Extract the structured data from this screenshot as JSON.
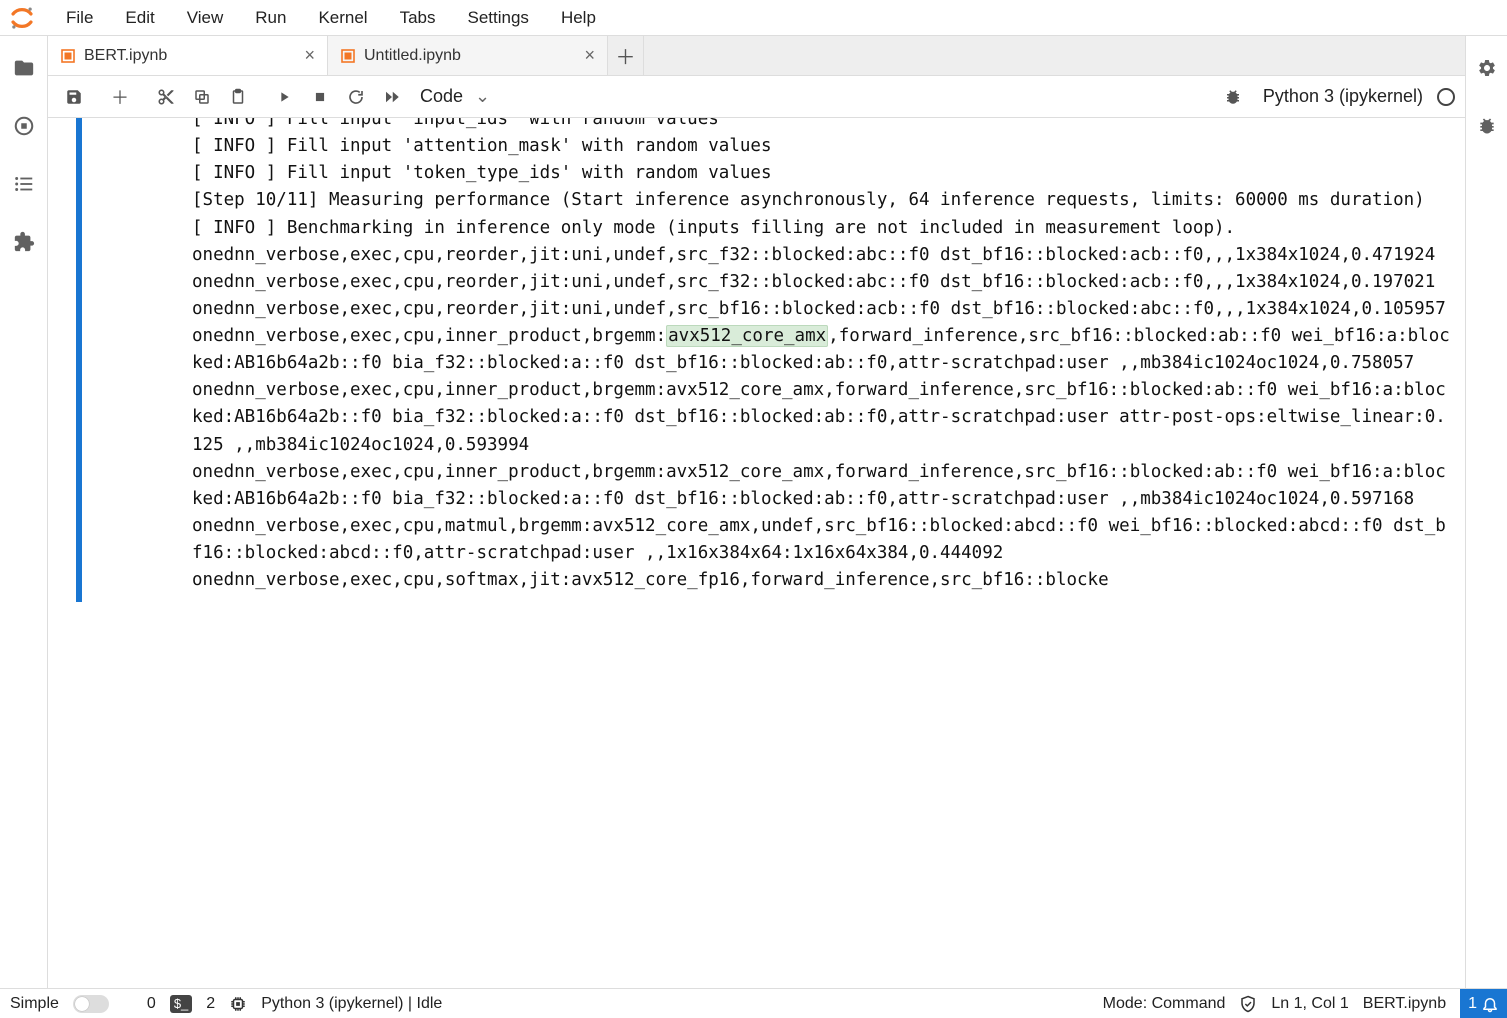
{
  "menu": {
    "items": [
      "File",
      "Edit",
      "View",
      "Run",
      "Kernel",
      "Tabs",
      "Settings",
      "Help"
    ]
  },
  "tabs": [
    {
      "label": "BERT.ipynb",
      "active": true
    },
    {
      "label": "Untitled.ipynb",
      "active": false
    }
  ],
  "toolbar": {
    "celltype": "Code",
    "kernel": "Python 3 (ipykernel)"
  },
  "output": {
    "lines_pre": [
      "[ INFO ] Fill input 'input_ids' with random values",
      "[ INFO ] Fill input 'attention_mask' with random values",
      "[ INFO ] Fill input 'token_type_ids' with random values",
      "[Step 10/11] Measuring performance (Start inference asynchronously, 64 inference requests, limits: 60000 ms duration)",
      "[ INFO ] Benchmarking in inference only mode (inputs filling are not included in measurement loop).",
      "onednn_verbose,exec,cpu,reorder,jit:uni,undef,src_f32::blocked:abc::f0 dst_bf16::blocked:acb::f0,,,1x384x1024,0.471924",
      "onednn_verbose,exec,cpu,reorder,jit:uni,undef,src_f32::blocked:abc::f0 dst_bf16::blocked:acb::f0,,,1x384x1024,0.197021",
      "onednn_verbose,exec,cpu,reorder,jit:uni,undef,src_bf16::blocked:acb::f0 dst_bf16::blocked:abc::f0,,,1x384x1024,0.105957"
    ],
    "hl_pre": "onednn_verbose,exec,cpu,inner_product,brgemm:",
    "hl_text": "avx512_core_amx",
    "hl_post": ",forward_inference,src_bf16::blocked:ab::f0 wei_bf16:a:blocked:AB16b64a2b::f0 bia_f32::blocked:a::f0 dst_bf16::blocked:ab::f0,attr-scratchpad:user ,,mb384ic1024oc1024,0.758057",
    "lines_post": [
      "onednn_verbose,exec,cpu,inner_product,brgemm:avx512_core_amx,forward_inference,src_bf16::blocked:ab::f0 wei_bf16:a:blocked:AB16b64a2b::f0 bia_f32::blocked:a::f0 dst_bf16::blocked:ab::f0,attr-scratchpad:user attr-post-ops:eltwise_linear:0.125 ,,mb384ic1024oc1024,0.593994",
      "onednn_verbose,exec,cpu,inner_product,brgemm:avx512_core_amx,forward_inference,src_bf16::blocked:ab::f0 wei_bf16:a:blocked:AB16b64a2b::f0 bia_f32::blocked:a::f0 dst_bf16::blocked:ab::f0,attr-scratchpad:user ,,mb384ic1024oc1024,0.597168",
      "onednn_verbose,exec,cpu,matmul,brgemm:avx512_core_amx,undef,src_bf16::blocked:abcd::f0 wei_bf16::blocked:abcd::f0 dst_bf16::blocked:abcd::f0,attr-scratchpad:user ,,1x16x384x64:1x16x64x384,0.444092",
      "onednn_verbose,exec,cpu,softmax,jit:avx512_core_fp16,forward_inference,src_bf16::blocke"
    ]
  },
  "status": {
    "simple": "Simple",
    "terminals_count": "0",
    "kernels_count": "2",
    "kernel_status": "Python 3 (ipykernel) | Idle",
    "mode": "Mode: Command",
    "cursor": "Ln 1, Col 1",
    "file": "BERT.ipynb",
    "notif_count": "1"
  }
}
